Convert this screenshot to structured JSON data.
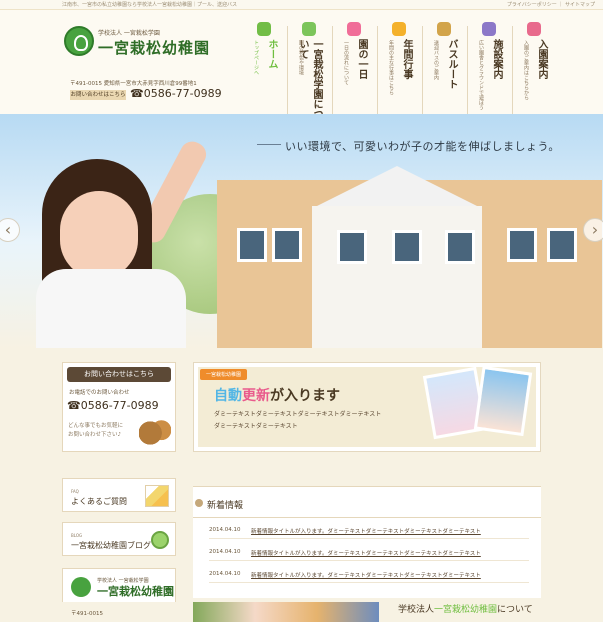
{
  "top": {
    "tagline": "江南市、一宮市の私立幼稚園なら学校法人一宮栽松幼稚園｜プール、送迎バス",
    "links": "プライバシーポリシー ｜ サイトマップ"
  },
  "header": {
    "org_small": "学校法人 一宮栽松学園",
    "org_big": "一宮栽松幼稚園",
    "address": "〒491-0015 愛知県一宮市大赤見字西川倉99番地1",
    "contact_label": "お問い合わせはこちら",
    "phone": "☎0586-77-0989"
  },
  "nav": [
    {
      "title": "ホーム",
      "sub": "トップページへ",
      "color": "#72bd46",
      "active": true
    },
    {
      "title": "一宮栽松学園について",
      "sub": "園の特色や環境",
      "color": "#7cc55b",
      "active": false
    },
    {
      "title": "園の一日",
      "sub": "一日の流れについて",
      "color": "#f06d98",
      "active": false
    },
    {
      "title": "年間行事",
      "sub": "年間の主な行事はこちら",
      "color": "#f4b12b",
      "active": false
    },
    {
      "title": "バスルート",
      "sub": "送迎バスのご案内",
      "color": "#d2a44a",
      "active": false
    },
    {
      "title": "施設案内",
      "sub": "広い園舎とグラウンドで遊ぼう",
      "color": "#8c78c8",
      "active": false
    },
    {
      "title": "入園案内",
      "sub": "入園のご案内はこちらから",
      "color": "#e86a8c",
      "active": false
    }
  ],
  "hero": {
    "copy": "いい環境で、可愛いわが子の才能を伸ばしましょう。",
    "left_arrow": "‹",
    "right_arrow": "›"
  },
  "sidebar": {
    "inquiry_title": "お問い合わせはこちら",
    "inquiry_sub": "お電話でのお問い合わせ",
    "inquiry_phone": "☎0586-77-0989",
    "inquiry_note": "どんな事でもお気軽に\nお問い合わせ下さい♪",
    "faq_mini": "FAQ",
    "faq_label": "よくあるご質問",
    "blog_mini": "BLOG",
    "blog_label": "一宮栽松幼稚園ブログ",
    "footer_small": "学校法人 一宮栽松学園",
    "footer_big": "一宮栽松幼稚園",
    "footer_zip": "〒491-0015"
  },
  "banner": {
    "ribbon": "一宮栽松幼稚園",
    "headline_a": "自動",
    "headline_b": "更新",
    "headline_c": "が入ります",
    "text": "ダミーテキストダミーテキストダミーテキストダミーテキスト\nダミーテキストダミーテキスト"
  },
  "news": {
    "title": "新着情報",
    "items": [
      {
        "date": "2014.04.10",
        "text": "新着情報タイトルが入ります。ダミーテキストダミーテキストダミーテキストダミーテキスト"
      },
      {
        "date": "2014.04.10",
        "text": "新着情報タイトルが入ります。ダミーテキストダミーテキストダミーテキストダミーテキスト"
      },
      {
        "date": "2014.04.10",
        "text": "新着情報タイトルが入ります。ダミーテキストダミーテキストダミーテキストダミーテキスト"
      }
    ]
  },
  "about": {
    "title_a": "学校法人",
    "title_b": "一宮栽松幼稚園",
    "title_c": "について"
  }
}
